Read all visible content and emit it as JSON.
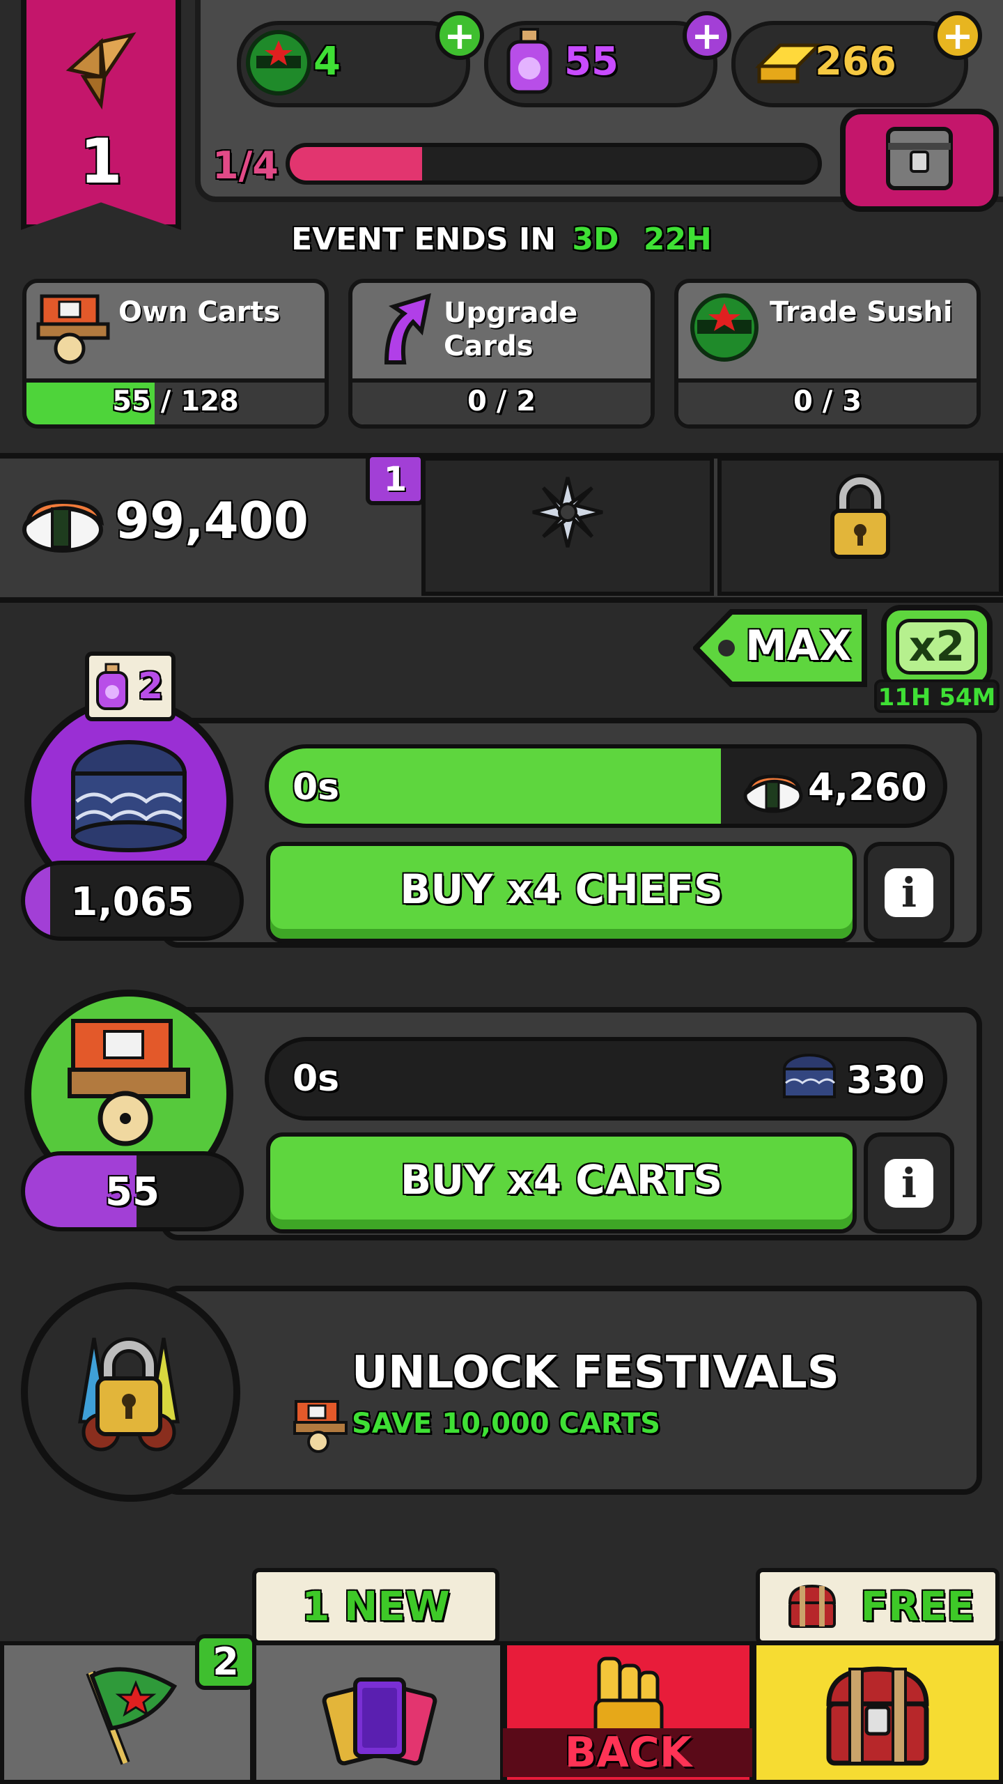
{
  "header": {
    "level": "1",
    "currencies": [
      {
        "icon": "ninja-mask-icon",
        "value": "4",
        "color": "#3fe035"
      },
      {
        "icon": "potion-jar-icon",
        "value": "55",
        "color": "#c84bff"
      },
      {
        "icon": "gold-bar-icon",
        "value": "266",
        "color": "#f5c842"
      }
    ],
    "progress_text": "1/4",
    "progress_fraction": 0.25
  },
  "event": {
    "label": "EVENT ENDS IN",
    "days": "3D",
    "hours": "22H"
  },
  "missions": [
    {
      "icon": "noodle-cart-icon",
      "title": "Own Carts",
      "progress": "55 / 128",
      "fraction": 0.43
    },
    {
      "icon": "upgrade-arrow-icon",
      "title": "Upgrade Cards",
      "progress": "0 / 2",
      "fraction": 0
    },
    {
      "icon": "ninja-mask-icon",
      "title": "Trade Sushi",
      "progress": "0 / 3",
      "fraction": 0
    }
  ],
  "sushi": {
    "total": "99,400",
    "slot_badge": "1"
  },
  "multiplier": {
    "max_label": "MAX",
    "boost_label": "x2",
    "boost_time": "11H 54M"
  },
  "chefs": {
    "badge_count": "2",
    "count": "1,065",
    "timer": "0s",
    "cost": "4,260",
    "timer_fill": 0.67,
    "buy_label": "BUY x4 CHEFS",
    "info": "i"
  },
  "carts": {
    "count": "55",
    "timer": "0s",
    "cost": "330",
    "buy_label": "BUY x4 CARTS",
    "info": "i"
  },
  "festival": {
    "title": "UNLOCK FESTIVALS",
    "requirement": "SAVE 10,000 CARTS"
  },
  "bottom_nav": {
    "flag_badge": "2",
    "cards_tag": "1 NEW",
    "back_label": "BACK",
    "chest_tag": "FREE"
  }
}
